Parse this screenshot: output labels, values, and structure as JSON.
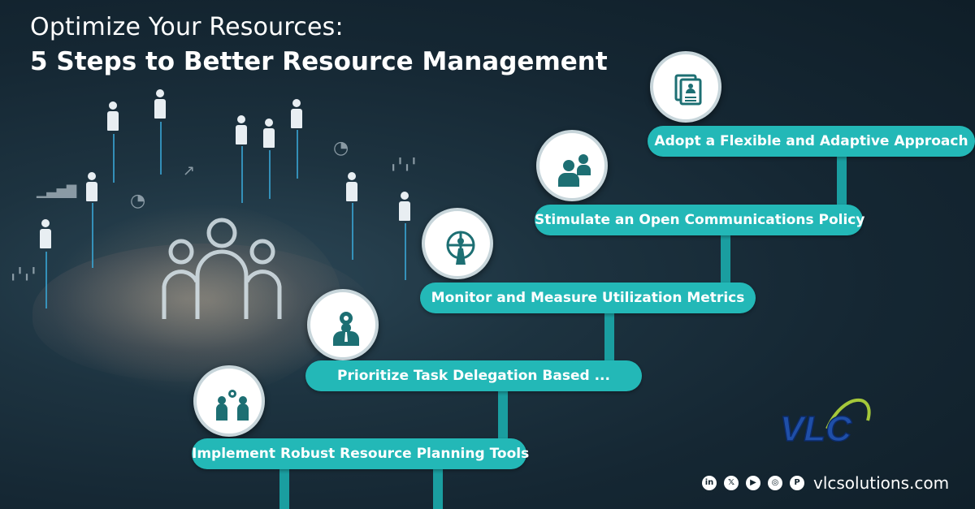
{
  "header": {
    "title_line1": "Optimize Your Resources:",
    "title_line2": "5 Steps to Better Resource Management"
  },
  "steps": [
    {
      "label": "Implement Robust Resource Planning Tools",
      "icon": "team-gear-icon"
    },
    {
      "label": "Prioritize Task Delegation Based ...",
      "icon": "manager-gear-icon"
    },
    {
      "label": "Monitor and Measure Utilization Metrics",
      "icon": "globe-person-icon"
    },
    {
      "label": "Stimulate an Open Communications Policy",
      "icon": "two-people-icon"
    },
    {
      "label": "Adopt a Flexible and Adaptive Approach",
      "icon": "documents-icon"
    }
  ],
  "brand": {
    "logo_text": "VLC",
    "website": "vlcsolutions.com",
    "accent": "#23b8b7",
    "connector": "#1a9ea0"
  },
  "social": [
    "in",
    "x",
    "yt",
    "ig",
    "p"
  ]
}
